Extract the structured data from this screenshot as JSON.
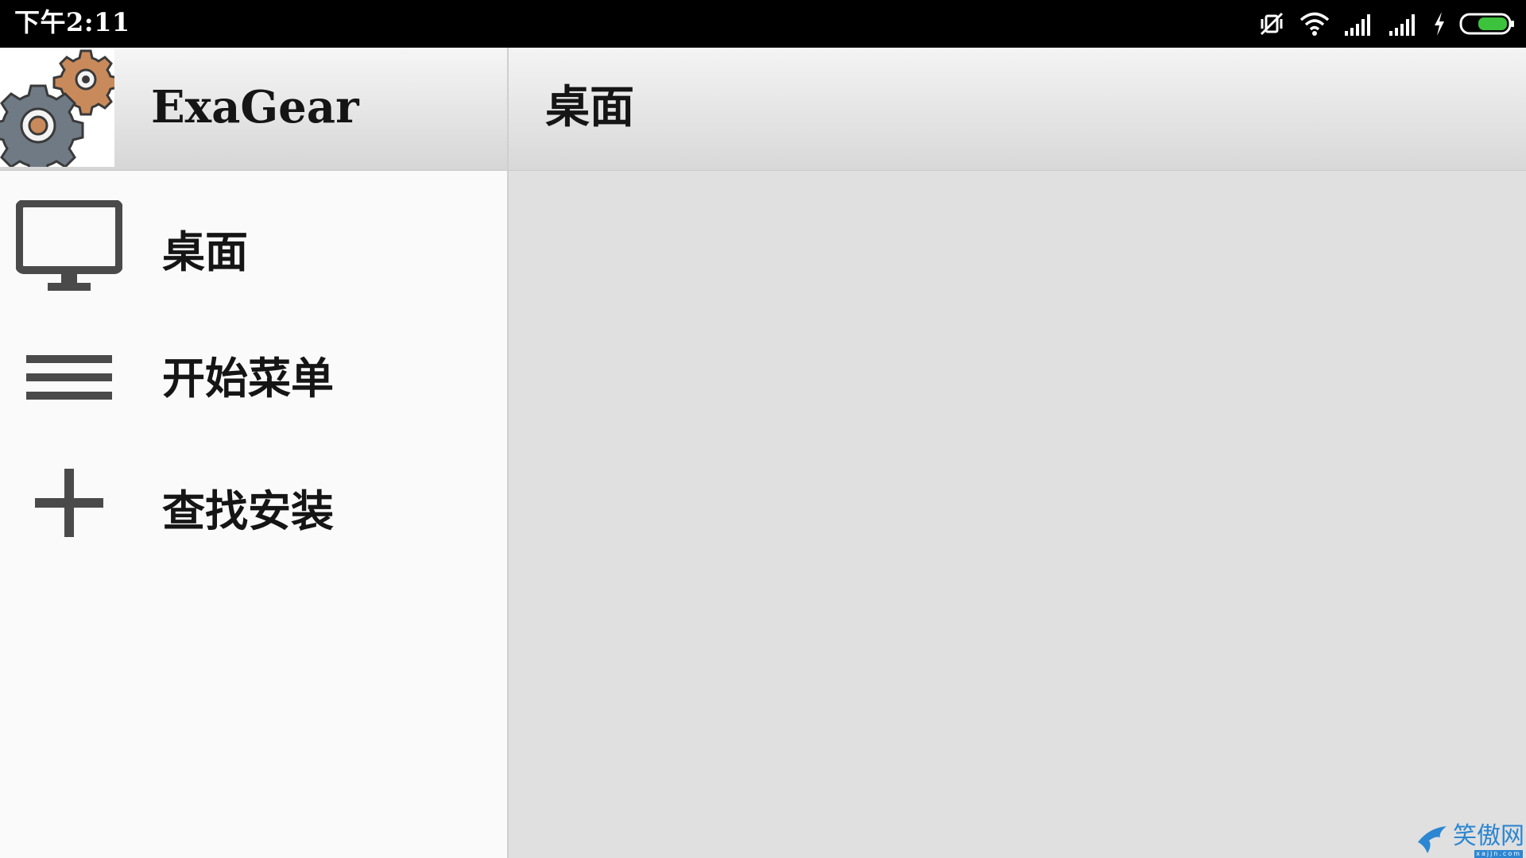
{
  "status_bar": {
    "time": "下午2:11",
    "icons": [
      "mute-icon",
      "wifi-icon",
      "signal-icon",
      "signal-icon",
      "charging-icon",
      "battery-icon"
    ],
    "battery_color": "#3cc23c"
  },
  "drawer": {
    "app_title": "ExaGear",
    "logo_icon": "gear-logo-icon",
    "items": [
      {
        "label": "桌面",
        "icon": "monitor-icon"
      },
      {
        "label": "开始菜单",
        "icon": "menu-lines-icon"
      },
      {
        "label": "查找安装",
        "icon": "plus-icon"
      }
    ]
  },
  "main": {
    "title": "桌面"
  },
  "watermark": {
    "text": "笑傲网",
    "sub": "xajjn.com"
  },
  "colors": {
    "icon_gray": "#4a4a4a",
    "gear_gray": "#6f7a85",
    "gear_orange": "#c98a5b",
    "watermark_blue": "#2d86d1"
  }
}
